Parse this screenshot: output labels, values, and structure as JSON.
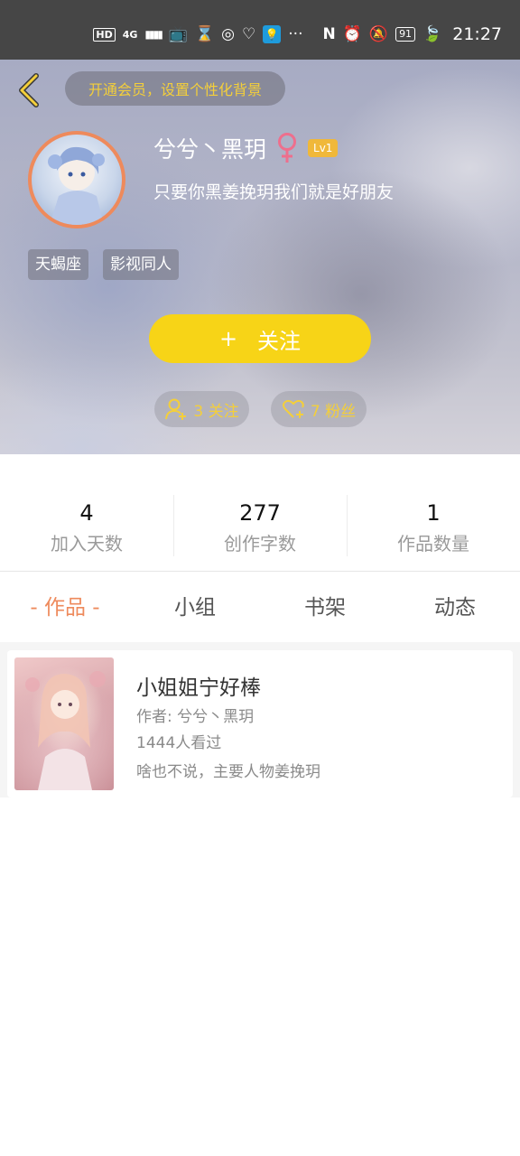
{
  "status_bar": {
    "indicators": [
      "HD",
      "4G",
      "▮▮▮▮"
    ],
    "time": "21:27",
    "battery": "91",
    "overflow": "···"
  },
  "header": {
    "vip_prompt": "开通会员，设置个性化背景",
    "username": "兮兮丶黑玥",
    "level": "Lv1",
    "bio": "只要你黑姜挽玥我们就是好朋友",
    "tags": [
      "天蝎座",
      "影视同人"
    ],
    "follow_button": {
      "plus": "+",
      "label": "关注"
    },
    "following_text": "3 关注",
    "fans_text": "7 粉丝",
    "accent_colors": {
      "yellow": "#f7d417",
      "orange": "#ee8a5c",
      "female": "#ee6f8d"
    }
  },
  "stats": [
    {
      "value": "4",
      "label": "加入天数"
    },
    {
      "value": "277",
      "label": "创作字数"
    },
    {
      "value": "1",
      "label": "作品数量"
    }
  ],
  "tabs": [
    {
      "label": "- 作品 -",
      "active": true
    },
    {
      "label": "小组",
      "active": false
    },
    {
      "label": "书架",
      "active": false
    },
    {
      "label": "动态",
      "active": false
    }
  ],
  "works": [
    {
      "title": "小姐姐宁好棒",
      "author": "作者: 兮兮丶黑玥",
      "views": "1444人看过",
      "summary": "啥也不说，主要人物姜挽玥"
    }
  ]
}
